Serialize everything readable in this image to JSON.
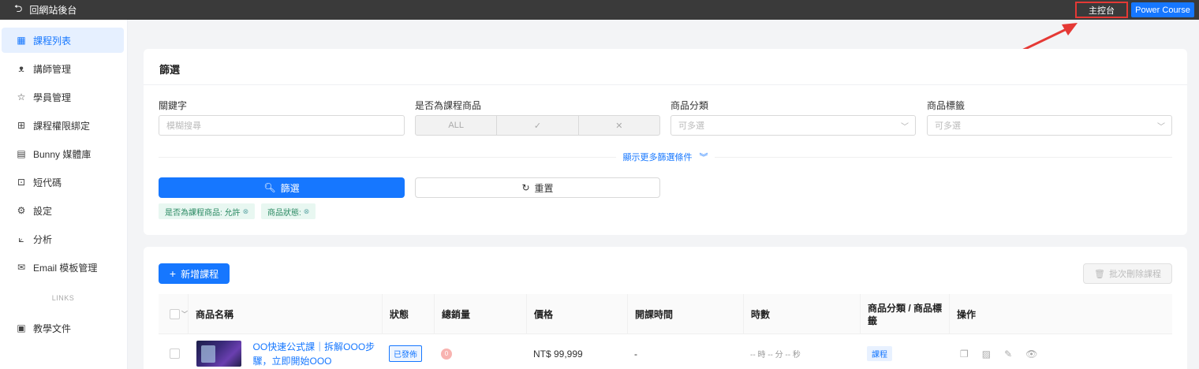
{
  "topbar": {
    "back_label": "回網站後台",
    "dashboard_label": "主控台",
    "power_course_label": "Power Course"
  },
  "sidebar": {
    "items": [
      {
        "label": "課程列表",
        "icon": "table-icon",
        "active": true
      },
      {
        "label": "講師管理",
        "icon": "user-icon"
      },
      {
        "label": "學員管理",
        "icon": "student-icon"
      },
      {
        "label": "課程權限綁定",
        "icon": "grid-icon"
      },
      {
        "label": "Bunny 媒體庫",
        "icon": "media-library-icon"
      },
      {
        "label": "短代碼",
        "icon": "code-icon"
      },
      {
        "label": "設定",
        "icon": "gear-icon"
      },
      {
        "label": "分析",
        "icon": "chart-icon"
      },
      {
        "label": "Email 模板管理",
        "icon": "mail-icon"
      }
    ],
    "links_heading": "LINKS",
    "link_items": [
      {
        "label": "教學文件",
        "icon": "book-icon"
      }
    ]
  },
  "filter": {
    "title": "篩選",
    "keyword_label": "關鍵字",
    "keyword_placeholder": "模糊搜尋",
    "is_course_label": "是否為課程商品",
    "is_course_options": [
      "ALL",
      "✓",
      "✕"
    ],
    "category_label": "商品分類",
    "category_placeholder": "可多選",
    "tag_label": "商品標籤",
    "tag_placeholder": "可多選",
    "more_label": "顯示更多篩選條件",
    "search_button": "篩選",
    "reset_button": "重置",
    "active_tags": [
      "是否為課程商品: 允許",
      "商品狀態:"
    ]
  },
  "list": {
    "add_button": "新增課程",
    "bulk_delete_button": "批次刪除課程",
    "columns": [
      "商品名稱",
      "狀態",
      "總銷量",
      "價格",
      "開課時間",
      "時數",
      "商品分類 / 商品標籤",
      "操作"
    ],
    "rows": [
      {
        "name": "OO快速公式課｜拆解OOO步驟，立即開始OOO",
        "status": "已發佈",
        "sales": "0",
        "price": "NT$ 99,999",
        "start_time": "-",
        "duration": "-- 時 -- 分 -- 秒",
        "category": "課程"
      }
    ]
  },
  "colors": {
    "accent": "#1677ff",
    "topbar_bg": "#3a3a3a",
    "highlight_border": "#e53935",
    "annotation_arrow": "#e53935"
  }
}
